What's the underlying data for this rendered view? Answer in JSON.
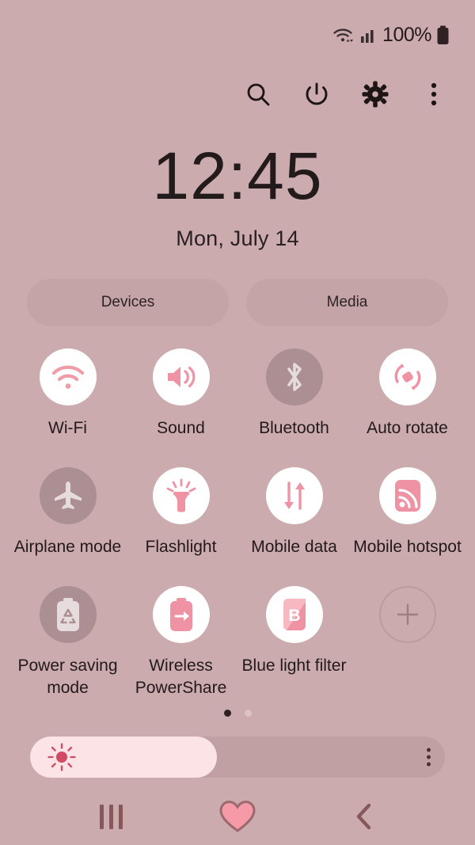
{
  "theme": {
    "background": "#cbabad",
    "accent_pink": "#ef93a4",
    "tile_on_bg": "#ffffff",
    "tile_off_bg": "#ab8f93",
    "pill_bg": "#c4a4a7",
    "text_dark": "#23191b"
  },
  "status_bar": {
    "wifi_icon": "wifi-data-icon",
    "signal_icon": "cellular-signal-icon",
    "battery_percent": "100%",
    "battery_icon": "battery-full-icon"
  },
  "header": {
    "search_icon": "search-icon",
    "power_icon": "power-icon",
    "settings_icon": "gear-icon",
    "more_icon": "more-vertical-icon"
  },
  "clock": {
    "time": "12:45",
    "date": "Mon, July 14"
  },
  "pills": [
    {
      "label": "Devices",
      "name": "devices-pill"
    },
    {
      "label": "Media",
      "name": "media-pill"
    }
  ],
  "toggles": [
    {
      "label": "Wi-Fi",
      "icon": "wifi-icon",
      "state": "on"
    },
    {
      "label": "Sound",
      "icon": "sound-icon",
      "state": "on"
    },
    {
      "label": "Bluetooth",
      "icon": "bluetooth-icon",
      "state": "off"
    },
    {
      "label": "Auto rotate",
      "icon": "auto-rotate-icon",
      "state": "on"
    },
    {
      "label": "Airplane mode",
      "icon": "airplane-icon",
      "state": "off"
    },
    {
      "label": "Flashlight",
      "icon": "flashlight-icon",
      "state": "on"
    },
    {
      "label": "Mobile data",
      "icon": "mobile-data-icon",
      "state": "on"
    },
    {
      "label": "Mobile hotspot",
      "icon": "mobile-hotspot-icon",
      "state": "on"
    },
    {
      "label": "Power saving mode",
      "icon": "power-saving-icon",
      "state": "off"
    },
    {
      "label": "Wireless PowerShare",
      "icon": "power-share-icon",
      "state": "on"
    },
    {
      "label": "Blue light filter",
      "icon": "blue-light-icon",
      "state": "on"
    },
    {
      "label": "",
      "icon": "add-icon",
      "state": "add"
    }
  ],
  "pagination": {
    "total": 2,
    "active": 1
  },
  "brightness": {
    "value_percent": 45,
    "sun_icon": "brightness-sun-icon",
    "menu_icon": "more-vertical-icon"
  },
  "navbar": {
    "recents_icon": "recents-icon",
    "home_icon": "heart-home-icon",
    "back_icon": "back-chevron-icon"
  }
}
